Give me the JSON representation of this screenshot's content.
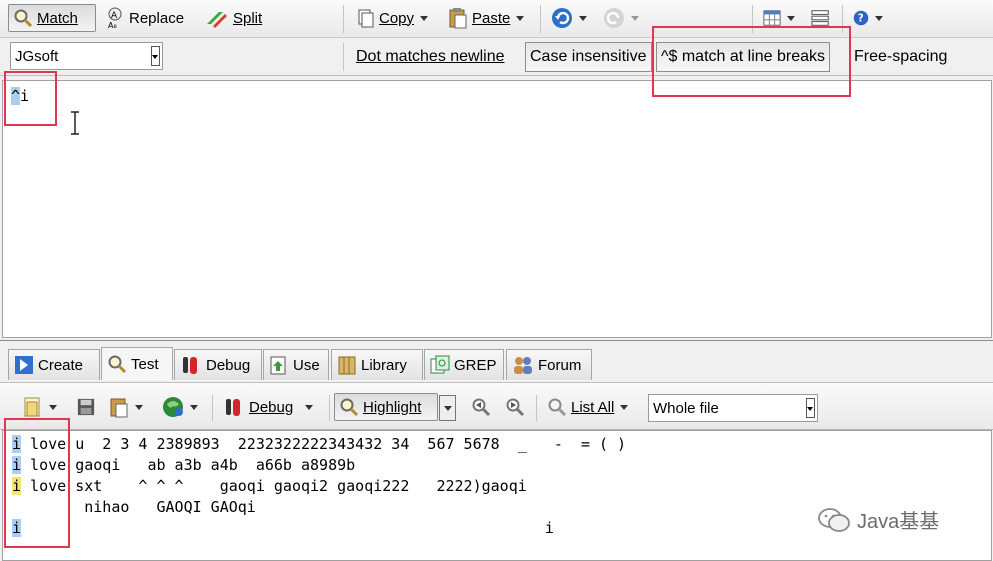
{
  "toolbar_main": {
    "match": "Match",
    "replace": "Replace",
    "split": "Split",
    "copy": "Copy",
    "paste": "Paste"
  },
  "toolbar_options": {
    "flavor": "JGsoft",
    "dot_newline": "Dot matches newline",
    "case_insensitive": "Case insensitive",
    "line_breaks": "^$ match at line breaks",
    "free_spacing": "Free-spacing"
  },
  "regex": {
    "caret": "^",
    "rest": "i"
  },
  "tabs": [
    {
      "label": "Create"
    },
    {
      "label": "Test"
    },
    {
      "label": "Debug"
    },
    {
      "label": "Use"
    },
    {
      "label": "Library"
    },
    {
      "label": "GREP"
    },
    {
      "label": "Forum"
    }
  ],
  "test_toolbar": {
    "debug": "Debug",
    "highlight": "Highlight",
    "list_all": "List All",
    "scope": "Whole file"
  },
  "test_lines": [
    {
      "first": "i",
      "rest": " love u  2 3 4 2389893  2232322222343432 34  567 5678  _   -  = ( )"
    },
    {
      "first": "i",
      "rest": " love gaoqi   ab a3b a4b  a66b a8989b"
    },
    {
      "first": "i",
      "rest": " love sxt    ^ ^ ^    gaoqi gaoqi2 gaoqi222   2222)gaoqi"
    },
    {
      "first": "",
      "rest": "        nihao   GAOQI GAOqi"
    },
    {
      "first": "i",
      "rest": ""
    },
    {
      "first": "",
      "rest": "                                                           i"
    }
  ],
  "watermark": "Java基基",
  "colors": {
    "match_blue": "#a8d0f7",
    "match_yellow": "#f7e46a",
    "annotation_red": "#e0364f"
  }
}
